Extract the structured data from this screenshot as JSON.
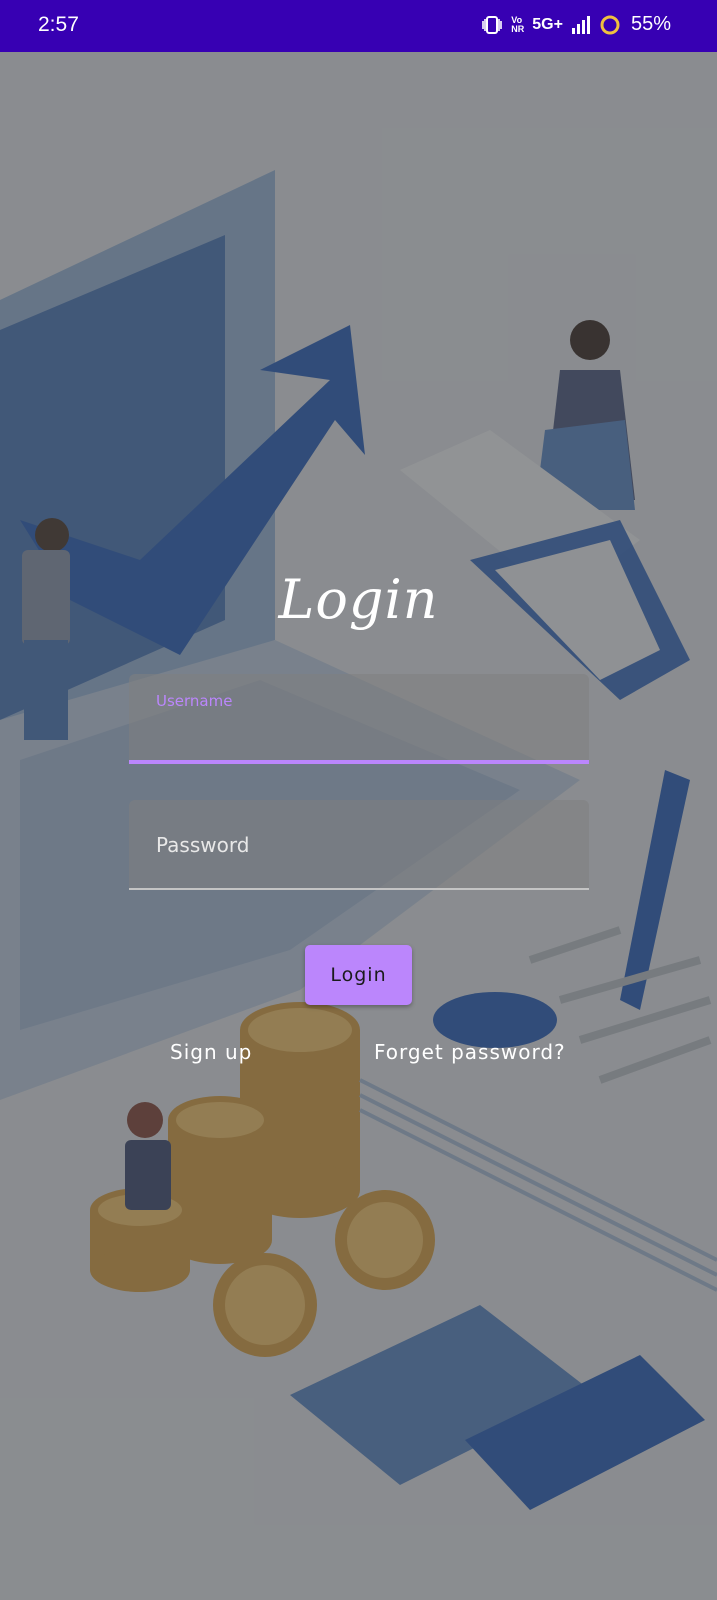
{
  "status_bar": {
    "time": "2:57",
    "network": "5G+",
    "volte_top": "Vo",
    "volte_bottom": "NR",
    "battery_percent": "55%",
    "icons": [
      "vibrate-icon",
      "volte-icon",
      "signal-icon",
      "battery-ring-icon"
    ]
  },
  "login": {
    "title": "Login",
    "username": {
      "label": "Username",
      "value": ""
    },
    "password": {
      "placeholder": "Password",
      "value": ""
    },
    "submit_label": "Login",
    "signup_label": "Sign up",
    "forgot_label": "Forget password?"
  },
  "colors": {
    "status_bar": "#3700b3",
    "accent": "#bb86fc",
    "overlay": "#5f5f5f"
  }
}
